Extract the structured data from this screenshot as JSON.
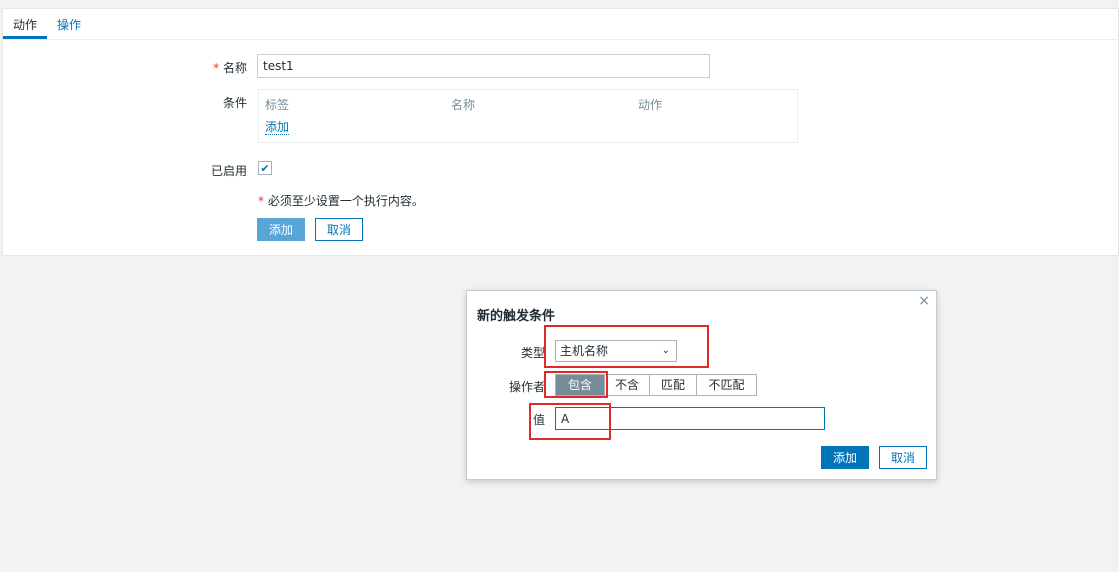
{
  "tabs": [
    {
      "label": "动作"
    },
    {
      "label": "操作"
    }
  ],
  "form": {
    "name_label": "名称",
    "name_value": "test1",
    "required_mark": "*",
    "conditions_label": "条件",
    "conditions_table": {
      "headers": [
        "标签",
        "名称",
        "动作"
      ],
      "add_link": "添加"
    },
    "enabled_label": "已启用",
    "enabled_checked": true,
    "hint_text": "必须至少设置一个执行内容。",
    "add_button": "添加",
    "cancel_button": "取消"
  },
  "dialog": {
    "title": "新的触发条件",
    "close_icon": "×",
    "type_label": "类型",
    "type_value": "主机名称",
    "operator_label": "操作者",
    "operators": [
      "包含",
      "不含",
      "匹配",
      "不匹配"
    ],
    "operator_selected": "包含",
    "value_label": "值",
    "value_value": "A",
    "add_button": "添加",
    "cancel_button": "取消"
  },
  "colors": {
    "accent": "#0275b8",
    "highlight": "#e02a2a",
    "selected_segment": "#768d99"
  }
}
